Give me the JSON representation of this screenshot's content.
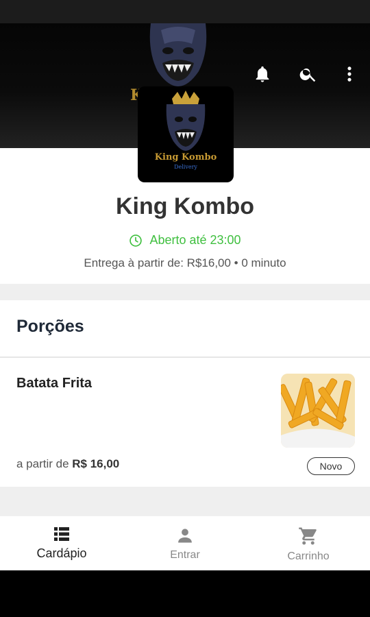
{
  "header": {
    "brand_fragment": "K"
  },
  "store": {
    "logo_text": "King Kombo",
    "logo_subtext": "Delivery",
    "name": "King Kombo",
    "status": "Aberto até 23:00",
    "delivery": "Entrega à partir de: R$16,00 • 0 minuto"
  },
  "sections": [
    {
      "title": "Porções",
      "products": [
        {
          "name": "Batata Frita",
          "price_prefix": "a partir de ",
          "price": "R$ 16,00",
          "badge": "Novo"
        }
      ]
    }
  ],
  "nav": {
    "items": [
      {
        "label": "Cardápio",
        "icon": "menu-list-icon",
        "active": true
      },
      {
        "label": "Entrar",
        "icon": "person-icon",
        "active": false
      },
      {
        "label": "Carrinho",
        "icon": "cart-icon",
        "active": false
      }
    ]
  },
  "colors": {
    "open_status": "#3fbf3f",
    "brand_gold": "#b08a2e"
  }
}
